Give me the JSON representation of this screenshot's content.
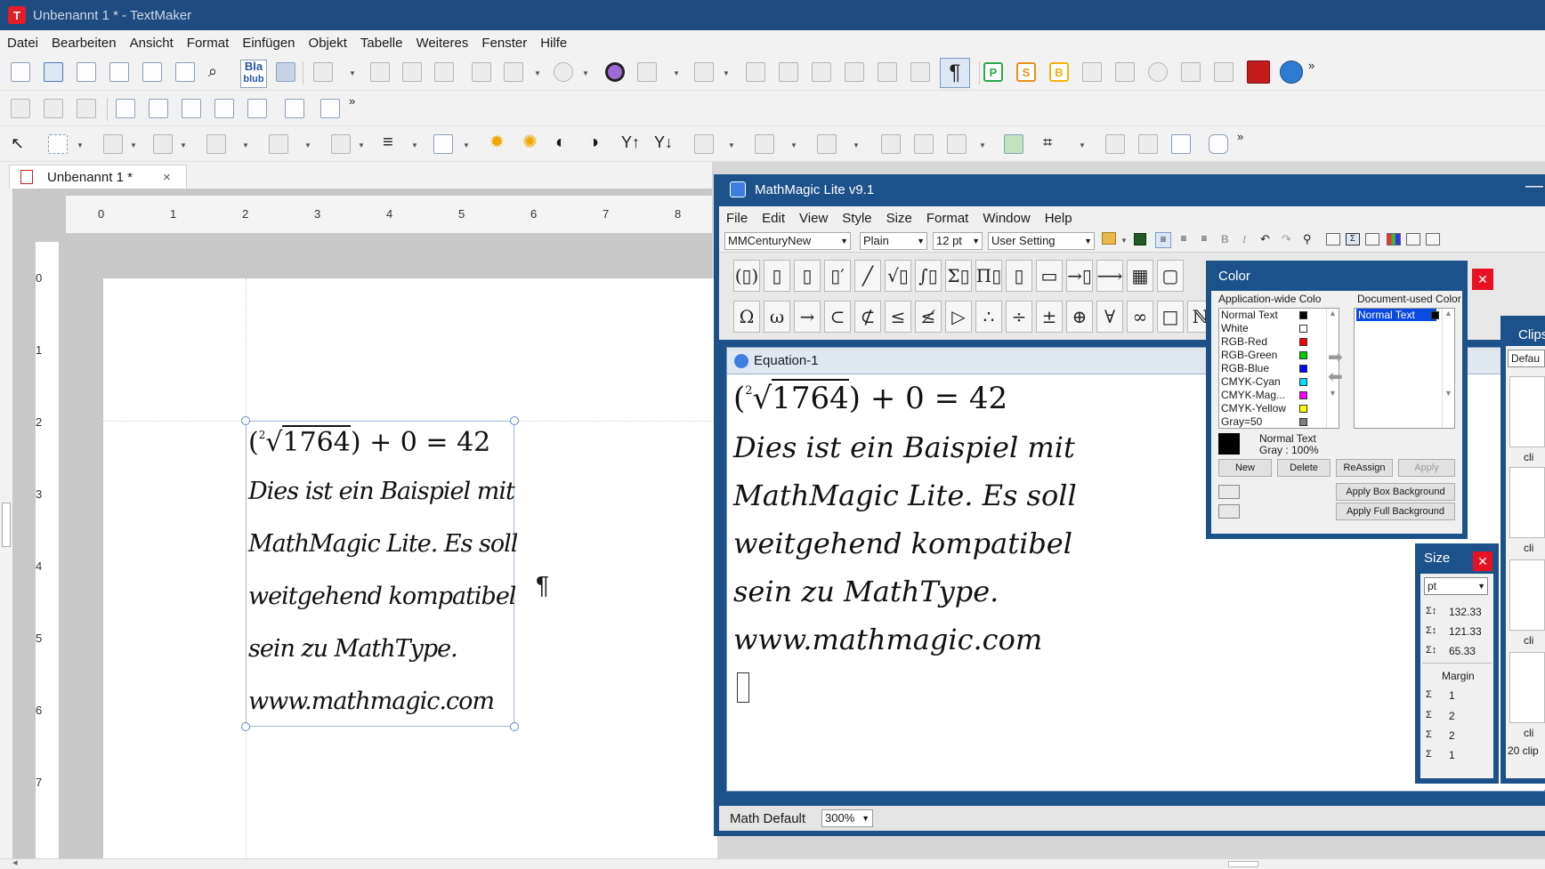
{
  "textmaker": {
    "title": "Unbenannt 1 * - TextMaker",
    "logo_letter": "T",
    "menu": [
      "Datei",
      "Bearbeiten",
      "Ansicht",
      "Format",
      "Einfügen",
      "Objekt",
      "Tabelle",
      "Weiteres",
      "Fenster",
      "Hilfe"
    ],
    "toolbar_buttons": {
      "bla_label": "Bla",
      "blub_label": "blub",
      "pilcrow": "¶",
      "p_label": "P",
      "s_label": "S",
      "b_label": "B",
      "more": "»"
    },
    "doc_tab": {
      "label": "Unbenannt 1 *",
      "close": "×"
    },
    "ruler_h": [
      "0",
      "1",
      "2",
      "3",
      "4",
      "5",
      "6",
      "7",
      "8"
    ],
    "ruler_v": [
      "0",
      "1",
      "2",
      "3",
      "4",
      "5",
      "6",
      "7"
    ],
    "pilcrow_mark": "¶",
    "equation": {
      "root_index": "2",
      "radicand": "1764",
      "rest": "+ 0 = 42",
      "lines": [
        "Dies ist ein Baispiel mit",
        "MathMagic Lite. Es soll",
        "weitgehend kompatibel",
        "sein zu MathType.",
        "www.mathmagic.com"
      ]
    }
  },
  "mathmagic": {
    "title": "MathMagic Lite v9.1",
    "menu": [
      "File",
      "Edit",
      "View",
      "Style",
      "Size",
      "Format",
      "Window",
      "Help"
    ],
    "font_combo": "MMCenturyNew",
    "style_combo": "Plain",
    "size_combo": "12 pt",
    "setting_combo": "User Setting",
    "style_buttons": {
      "bold": "B",
      "italic": "I"
    },
    "palette_row1": [
      "(▯)",
      "▯",
      "▯",
      "▯′",
      "╱",
      "√▯",
      "∫▯",
      "Σ▯",
      "Π▯",
      "▯",
      "▭",
      "→▯",
      "⟶",
      "▦",
      "▢"
    ],
    "palette_row2": [
      "Ω",
      "ω",
      "→",
      "⊂",
      "⊄",
      "≤",
      "≰",
      "▷",
      "∴",
      "÷",
      "±",
      "⊕",
      "∀",
      "∞",
      "□",
      "ℕ"
    ],
    "equation_window": {
      "title": "Equation-1",
      "root_index": "2",
      "radicand": "1764",
      "rest": "+ 0 = 42",
      "lines": [
        "Dies ist ein Baispiel mit",
        "MathMagic Lite. Es soll",
        "weitgehend kompatibel",
        "sein zu MathType.",
        "www.mathmagic.com"
      ]
    },
    "status": {
      "style": "Math Default",
      "zoom": "300%"
    }
  },
  "color_palette": {
    "title": "Color",
    "app_header": "Application-wide Colo",
    "doc_header": "Document-used Color",
    "app_colors": [
      {
        "name": "Normal Text",
        "color": "#000000"
      },
      {
        "name": "White",
        "color": "#ffffff"
      },
      {
        "name": "RGB-Red",
        "color": "#ff0000"
      },
      {
        "name": "RGB-Green",
        "color": "#00c000"
      },
      {
        "name": "RGB-Blue",
        "color": "#0000ff"
      },
      {
        "name": "CMYK-Cyan",
        "color": "#00e0f0"
      },
      {
        "name": "CMYK-Mag...",
        "color": "#ff00ff"
      },
      {
        "name": "CMYK-Yellow",
        "color": "#ffff00"
      },
      {
        "name": "Gray=50",
        "color": "#808080"
      }
    ],
    "doc_colors": [
      {
        "name": "Normal Text",
        "color": "#000000"
      }
    ],
    "selected_name": "Normal Text",
    "selected_value": "Gray : 100%",
    "buttons": {
      "new": "New",
      "delete": "Delete",
      "reassign": "ReAssign",
      "apply": "Apply"
    },
    "apply_box": "Apply Box Background",
    "apply_full": "Apply Full Background"
  },
  "size_palette": {
    "title": "Size",
    "unit": "pt",
    "values": [
      "132.33",
      "121.33",
      "65.33"
    ],
    "margin_label": "Margin",
    "margins": [
      "1",
      "2",
      "2",
      "1"
    ]
  },
  "clips_palette": {
    "title": "Clips",
    "combo": "Defau",
    "labels": [
      "cli",
      "cli",
      "cli",
      "cli"
    ],
    "footer": "20 clip"
  },
  "colors": {
    "titlebar_blue": "#1e4b80",
    "window_blue": "#1c5289",
    "close_red": "#e81123"
  }
}
